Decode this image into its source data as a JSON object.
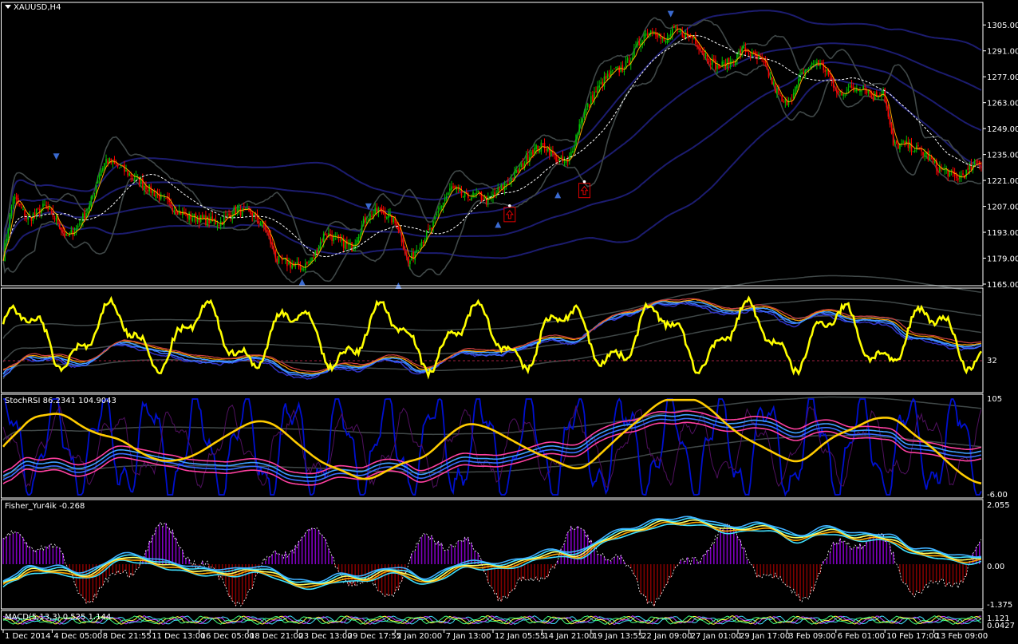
{
  "window": {
    "symbol_label": "XAUUSD,H4",
    "menu_arrow_icon": "triangle-down-icon"
  },
  "colors": {
    "background": "#000000",
    "frame": "#ffffff",
    "bull_candle": "#00c000",
    "bear_candle": "#ff0000",
    "bollinger": "#404848",
    "trend_band": "#1c1c70",
    "ma_dashed": "#ffffff",
    "ma_orange": "#ffa500",
    "rsi_yellow": "#ffff00",
    "stoch_yellow": "#ffcc00",
    "stoch_blue": "#0010d0",
    "ribbon_blue": "#3a70ff",
    "ribbon_pink": "#ff40a0",
    "ribbon_cyan": "#40e0ff",
    "hist_up": "#8000c0",
    "hist_down": "#800000",
    "arrow_marker": "#e00000"
  },
  "price_axis": {
    "ticks": [
      "1305.00",
      "1291.00",
      "1277.00",
      "1263.00",
      "1249.00",
      "1235.00",
      "1221.00",
      "1207.00",
      "1193.00",
      "1179.00",
      "1165.00"
    ]
  },
  "rsi_panel": {
    "label": "",
    "tick": "32"
  },
  "stoch_panel": {
    "label": "StochRSI 86.2341 104.9043",
    "ticks": [
      "105",
      "-6.00"
    ]
  },
  "fisher_panel": {
    "label": "Fisher_Yur4ik -0.268",
    "ticks": [
      "2.055",
      "0.00",
      "-1.375"
    ]
  },
  "macd_panel": {
    "label": "MACD(5,13,3) 0.525 1.144",
    "ticks": [
      "1.121",
      "0.0427"
    ]
  },
  "time_axis": {
    "labels": [
      "1 Dec 2014",
      "4 Dec 05:00",
      "8 Dec 21:55",
      "11 Dec 13:00",
      "16 Dec 05:00",
      "18 Dec 21:00",
      "23 Dec 13:00",
      "29 Dec 17:55",
      "2 Jan 20:00",
      "7 Jan 13:00",
      "12 Jan 05:55",
      "14 Jan 21:00",
      "19 Jan 13:55",
      "22 Jan 09:00",
      "27 Jan 01:00",
      "29 Jan 17:00",
      "3 Feb 09:00",
      "6 Feb 01:00",
      "10 Feb 17:00",
      "13 Feb 09:00"
    ]
  },
  "chart_data": {
    "type": "candlestick",
    "symbol": "XAUUSD",
    "timeframe": "H4",
    "ylim": [
      1165,
      1312
    ],
    "price_anchors": [
      [
        0,
        1180
      ],
      [
        6,
        1212
      ],
      [
        15,
        1200
      ],
      [
        25,
        1207
      ],
      [
        32,
        1200
      ],
      [
        38,
        1190
      ],
      [
        44,
        1195
      ],
      [
        52,
        1207
      ],
      [
        58,
        1225
      ],
      [
        62,
        1232
      ],
      [
        70,
        1228
      ],
      [
        80,
        1222
      ],
      [
        90,
        1215
      ],
      [
        100,
        1208
      ],
      [
        110,
        1202
      ],
      [
        120,
        1200
      ],
      [
        130,
        1198
      ],
      [
        140,
        1205
      ],
      [
        150,
        1203
      ],
      [
        158,
        1195
      ],
      [
        165,
        1178
      ],
      [
        172,
        1176
      ],
      [
        180,
        1174
      ],
      [
        186,
        1178
      ],
      [
        194,
        1193
      ],
      [
        202,
        1188
      ],
      [
        210,
        1185
      ],
      [
        218,
        1200
      ],
      [
        226,
        1205
      ],
      [
        232,
        1202
      ],
      [
        238,
        1196
      ],
      [
        244,
        1176
      ],
      [
        250,
        1186
      ],
      [
        258,
        1195
      ],
      [
        264,
        1208
      ],
      [
        270,
        1217
      ],
      [
        278,
        1212
      ],
      [
        286,
        1213
      ],
      [
        292,
        1210
      ],
      [
        298,
        1215
      ],
      [
        306,
        1222
      ],
      [
        312,
        1228
      ],
      [
        318,
        1237
      ],
      [
        326,
        1240
      ],
      [
        334,
        1232
      ],
      [
        340,
        1230
      ],
      [
        348,
        1254
      ],
      [
        356,
        1268
      ],
      [
        362,
        1275
      ],
      [
        368,
        1280
      ],
      [
        374,
        1282
      ],
      [
        380,
        1290
      ],
      [
        386,
        1300
      ],
      [
        392,
        1303
      ],
      [
        398,
        1295
      ],
      [
        404,
        1302
      ],
      [
        410,
        1300
      ],
      [
        416,
        1298
      ],
      [
        422,
        1290
      ],
      [
        430,
        1282
      ],
      [
        438,
        1285
      ],
      [
        446,
        1292
      ],
      [
        452,
        1288
      ],
      [
        458,
        1284
      ],
      [
        464,
        1272
      ],
      [
        470,
        1262
      ],
      [
        476,
        1268
      ],
      [
        482,
        1280
      ],
      [
        490,
        1285
      ],
      [
        496,
        1280
      ],
      [
        502,
        1268
      ],
      [
        510,
        1270
      ],
      [
        518,
        1272
      ],
      [
        524,
        1266
      ],
      [
        530,
        1270
      ],
      [
        536,
        1240
      ],
      [
        544,
        1240
      ],
      [
        550,
        1238
      ],
      [
        556,
        1235
      ],
      [
        562,
        1228
      ],
      [
        568,
        1226
      ],
      [
        574,
        1222
      ],
      [
        580,
        1225
      ],
      [
        586,
        1230
      ]
    ],
    "signal_arrows": {
      "down": [
        [
          32,
          1233
        ],
        [
          220,
          1206
        ],
        [
          402,
          1310
        ]
      ],
      "up": [
        [
          180,
          1167
        ],
        [
          238,
          1165
        ],
        [
          298,
          1198
        ],
        [
          334,
          1214
        ]
      ]
    },
    "indicators": [
      "Bollinger Bands",
      "Moving Average",
      "RSI",
      "StochRSI",
      "Fisher_Yur4ik",
      "MACD(5,13,3)"
    ]
  }
}
